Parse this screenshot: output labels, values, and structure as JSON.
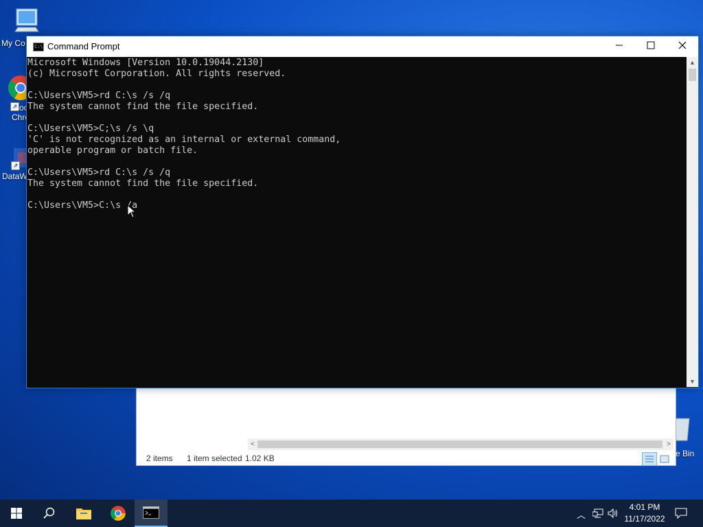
{
  "desktop": {
    "icons": [
      {
        "label": "My Co"
      },
      {
        "label": "Goo\nChro"
      },
      {
        "label": "DataW"
      },
      {
        "label": "e Bin"
      }
    ]
  },
  "explorer": {
    "status_items": "2 items",
    "status_selected": "1 item selected",
    "status_size": "1.02 KB"
  },
  "cmd": {
    "title": "Command Prompt",
    "console_lines": [
      "Microsoft Windows [Version 10.0.19044.2130]",
      "(c) Microsoft Corporation. All rights reserved.",
      "",
      "C:\\Users\\VM5>rd C:\\s /s /q",
      "The system cannot find the file specified.",
      "",
      "C:\\Users\\VM5>C;\\s /s \\q",
      "'C' is not recognized as an internal or external command,",
      "operable program or batch file.",
      "",
      "C:\\Users\\VM5>rd C:\\s /s /q",
      "The system cannot find the file specified.",
      "",
      "C:\\Users\\VM5>C:\\s /a"
    ]
  },
  "taskbar": {
    "time": "4:01 PM",
    "date": "11/17/2022"
  },
  "colors": {
    "console_bg": "#0c0c0c",
    "console_fg": "#cccccc",
    "taskbar_bg": "#101f3a",
    "accent": "#76b9ed"
  }
}
